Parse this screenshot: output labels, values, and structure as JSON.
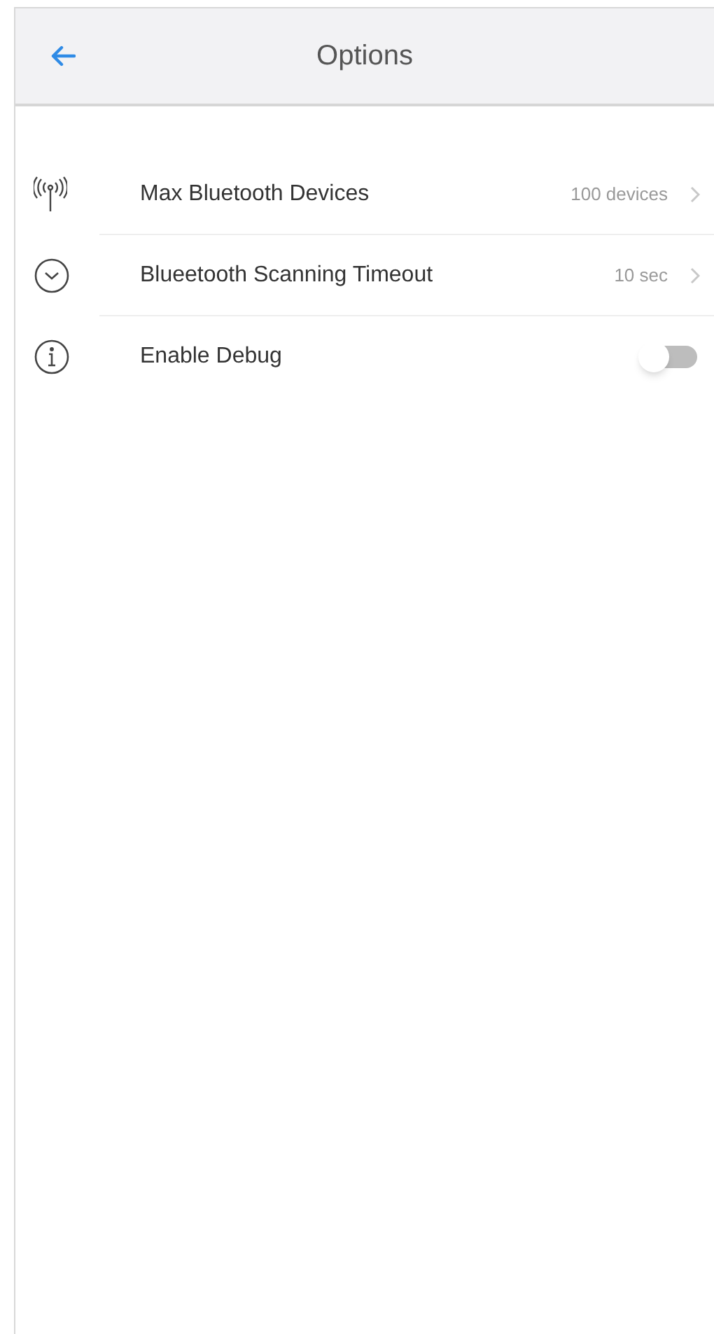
{
  "header": {
    "title": "Options"
  },
  "settings": [
    {
      "kind": "link",
      "label": "Max Bluetooth Devices",
      "value": "100 devices"
    },
    {
      "kind": "link",
      "label": "Blueetooth Scanning Timeout",
      "value": "10 sec"
    },
    {
      "kind": "toggle",
      "label": "Enable Debug",
      "on": false
    }
  ]
}
